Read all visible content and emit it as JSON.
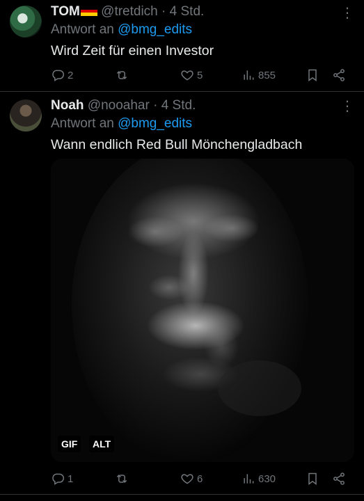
{
  "colors": {
    "background": "#000000",
    "text": "#e7e9ea",
    "secondary": "#71767b",
    "link": "#1d9bf0",
    "divider": "#2f3336"
  },
  "tweets": [
    {
      "name": "TOM",
      "handle": "@tretdich",
      "separator": "·",
      "time": "4 Std.",
      "reply_prefix": "Antwort an",
      "reply_mention": "@bmg_edits",
      "text": "Wird Zeit für einen Investor",
      "replies": "2",
      "retweets": "",
      "likes": "5",
      "views": "855"
    },
    {
      "name": "Noah",
      "handle": "@nooahar",
      "separator": "·",
      "time": "4 Std.",
      "reply_prefix": "Antwort an",
      "reply_mention": "@bmg_edits",
      "text": "Wann endlich Red Bull Mönchengladbach",
      "media_badges": [
        "GIF",
        "ALT"
      ],
      "replies": "1",
      "retweets": "",
      "likes": "6",
      "views": "630"
    }
  ],
  "icons": {
    "reply": "reply-icon",
    "retweet": "retweet-icon",
    "like": "heart-icon",
    "views": "views-icon",
    "bookmark": "bookmark-icon",
    "share": "share-icon",
    "more": "more-icon"
  }
}
